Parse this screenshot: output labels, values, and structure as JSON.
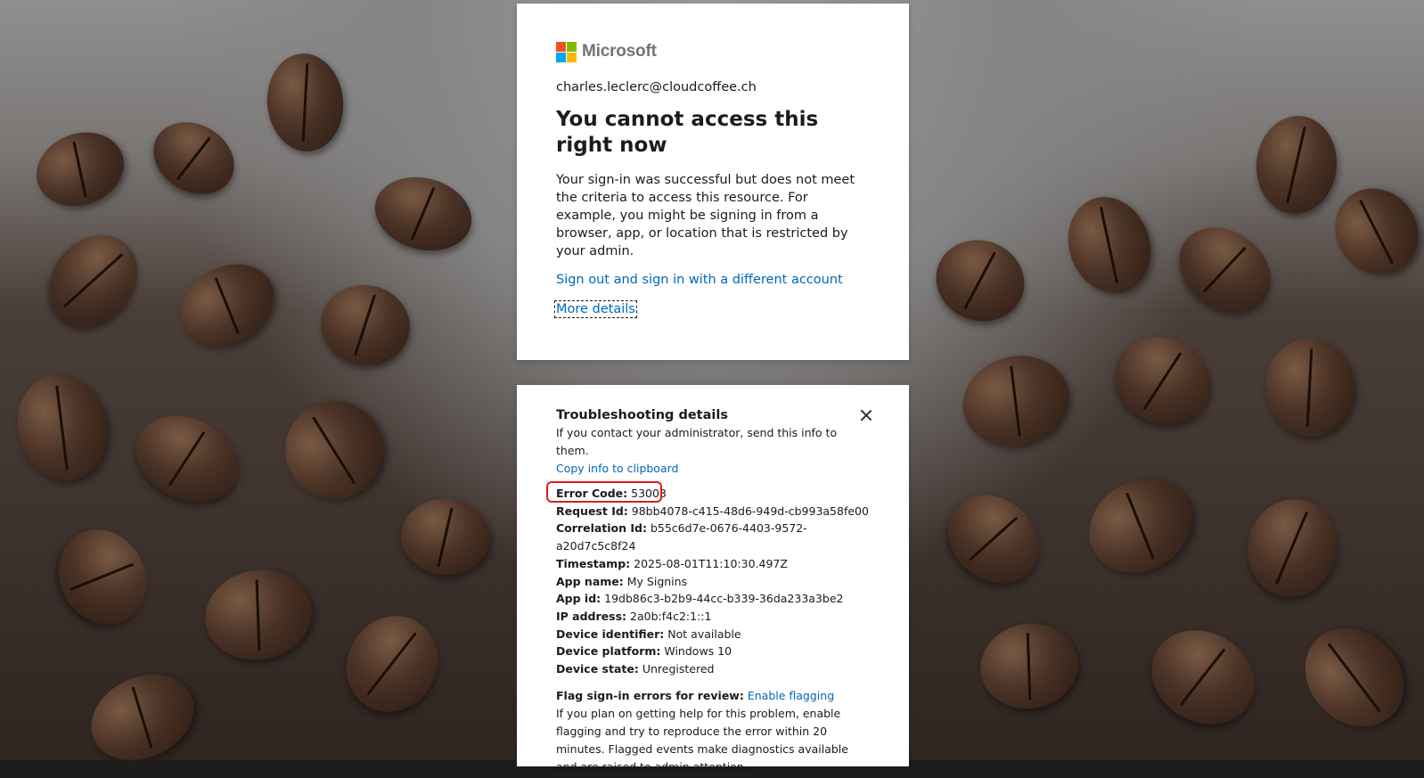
{
  "branding": {
    "company": "Microsoft",
    "colors": [
      "#f25022",
      "#7fba00",
      "#00a4ef",
      "#ffb900"
    ]
  },
  "signin": {
    "identity": "charles.leclerc@cloudcoffee.ch",
    "title": "You cannot access this right now",
    "description": "Your sign-in was successful but does not meet the criteria to access this resource. For example, you might be signing in from a browser, app, or location that is restricted by your admin.",
    "signout_link": "Sign out and sign in with a different account",
    "more_details_link": "More details"
  },
  "troubleshooting": {
    "title": "Troubleshooting details",
    "intro": "If you contact your administrator, send this info to them.",
    "copy_link": "Copy info to clipboard",
    "error_code": {
      "label": "Error Code:",
      "value": "53003"
    },
    "rows": [
      {
        "label": "Request Id:",
        "value": "98bb4078-c415-48d6-949d-cb993a58fe00"
      },
      {
        "label": "Correlation Id:",
        "value": "b55c6d7e-0676-4403-9572-a20d7c5c8f24"
      },
      {
        "label": "Timestamp:",
        "value": "2025-08-01T11:10:30.497Z"
      },
      {
        "label": "App name:",
        "value": "My Signins"
      },
      {
        "label": "App id:",
        "value": "19db86c3-b2b9-44cc-b339-36da233a3be2"
      },
      {
        "label": "IP address:",
        "value": "2a0b:f4c2:1::1"
      },
      {
        "label": "Device identifier:",
        "value": "Not available"
      },
      {
        "label": "Device platform:",
        "value": "Windows 10"
      },
      {
        "label": "Device state:",
        "value": "Unregistered"
      }
    ],
    "flag": {
      "label": "Flag sign-in errors for review:",
      "link": "Enable flagging",
      "description": "If you plan on getting help for this problem, enable flagging and try to reproduce the error within 20 minutes. Flagged events make diagnostics available and are raised to admin attention."
    },
    "highlight_color": "#e01b1b"
  },
  "icons": {
    "close": "close-icon",
    "logo": "microsoft-logo-icon"
  }
}
